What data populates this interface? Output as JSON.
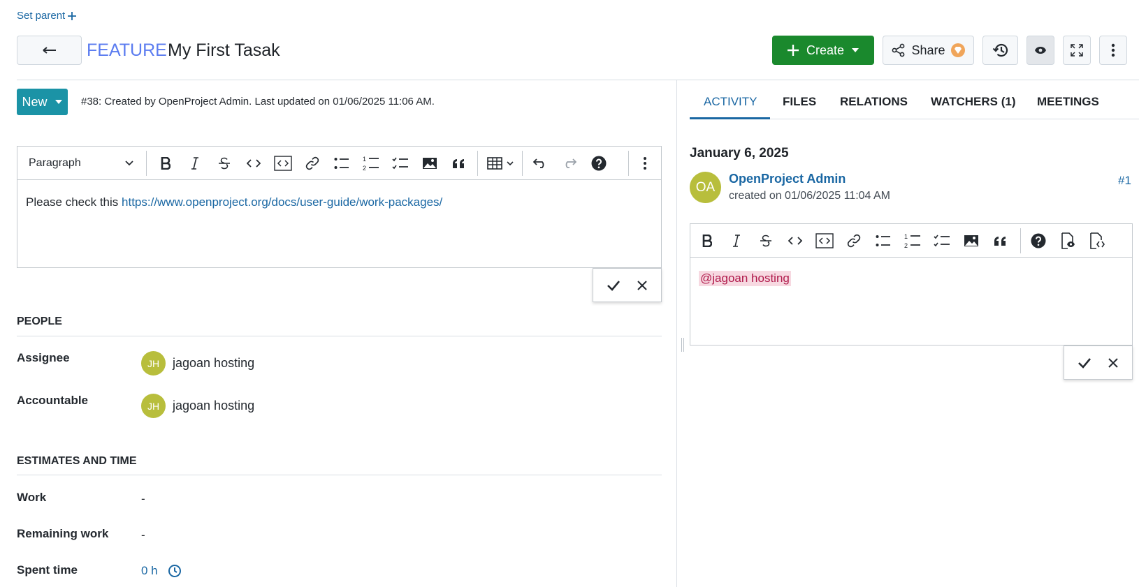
{
  "header": {
    "set_parent": "Set parent",
    "type": "FEATURE",
    "subject": "My First Tasak",
    "create_label": "Create",
    "share_label": "Share",
    "icons": [
      "arrow-left-icon",
      "plus-icon",
      "caret-down-icon",
      "share-icon",
      "enterprise-badge-icon",
      "history-icon",
      "eye-icon",
      "fullscreen-icon",
      "kebab-icon"
    ]
  },
  "status": {
    "label": "New",
    "meta": "#38: Created by OpenProject Admin. Last updated on 01/06/2025 11:06 AM."
  },
  "description_editor": {
    "paragraph_select": "Paragraph",
    "text": "Please check this ",
    "link": "https://www.openproject.org/docs/user-guide/work-packages/"
  },
  "people": {
    "title": "PEOPLE",
    "assignee_label": "Assignee",
    "assignee_initials": "JH",
    "assignee_name": "jagoan hosting",
    "accountable_label": "Accountable",
    "accountable_initials": "JH",
    "accountable_name": "jagoan hosting"
  },
  "estimates": {
    "title": "ESTIMATES AND TIME",
    "work_label": "Work",
    "work_value": "-",
    "remaining_label": "Remaining work",
    "remaining_value": "-",
    "spent_label": "Spent time",
    "spent_value": "0 h"
  },
  "tabs": [
    "ACTIVITY",
    "FILES",
    "RELATIONS",
    "WATCHERS (1)",
    "MEETINGS"
  ],
  "activity": {
    "date": "January 6, 2025",
    "avatar_initials": "OA",
    "author": "OpenProject Admin",
    "created": "created on 01/06/2025 11:04 AM",
    "number": "#1",
    "comment_mention": "@jagoan hosting"
  },
  "colors": {
    "create_green": "#1a892d",
    "status_teal": "#1b93a6",
    "link_blue": "#1a67a3",
    "type_blue": "#5b7cf0",
    "avatar_olive": "#b8be3c",
    "mention_bg": "#f7d9e1"
  }
}
